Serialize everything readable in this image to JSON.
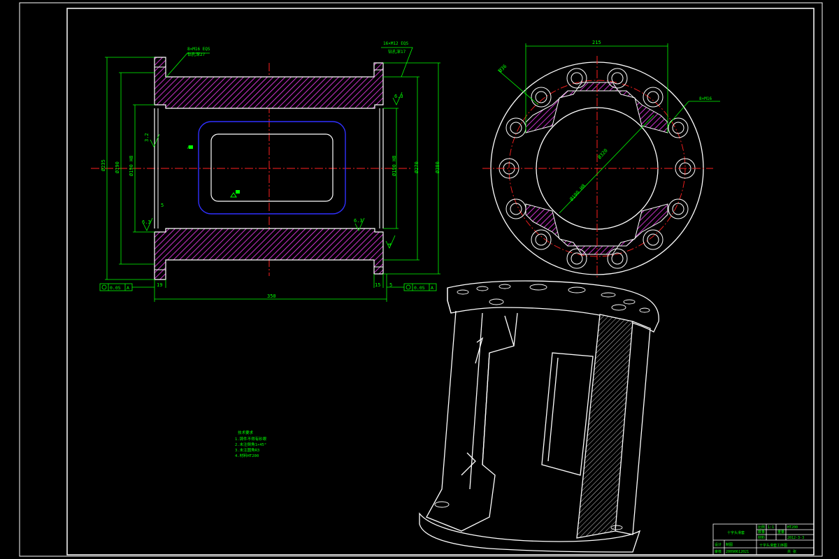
{
  "colors": {
    "background": "#000000",
    "outline": "#ffffff",
    "dimension": "#00ff00",
    "centerline": "#ff2020",
    "hatch": "#ff40ff",
    "hidden": "#3030ff",
    "leader": "#00ff00"
  },
  "front_view": {
    "dim_length": "350",
    "dim_left_flange": "19",
    "dim_right_flange": "15",
    "dim_right_small": "5",
    "dim_od_left": "Ø235",
    "dim_id_left": "Ø190",
    "dim_bore_left": "Ø190 H8",
    "dim_bore_right": "Ø190 H8",
    "dim_od_right": "Ø270",
    "dim_outer_right": "Ø380",
    "roughness_1": "6.3",
    "roughness_2": "6.3",
    "roughness_3": "6.3",
    "roughness_4": "3.2",
    "dim_groove": "5",
    "small_tick": "4",
    "note_left_top": "8×M16 EQS",
    "note_left_sub": "钻孔深27",
    "note_right_top": "16×M12 EQS",
    "note_right_sub": "钻孔深17",
    "tol_left": "0.05",
    "tol_left_ref": "A",
    "tol_right": "0.05",
    "tol_right_ref": "A",
    "marker_a": "A"
  },
  "side_view": {
    "dim_width": "215",
    "dim_hole": "Ø36",
    "dim_bolt_circle": "Ø320",
    "dim_inner": "Ø190 H8",
    "note_right": "8×M16"
  },
  "tech_notes": {
    "title": "技术要求",
    "line1": "1.铸件不得有砂眼",
    "line2": "2.未注倒角1×45°",
    "line3": "3.未注圆角R3",
    "line4": "4.材料HT200"
  },
  "title_block": {
    "company": "十字头滑套",
    "drawing_name": "十字头滑套工序图",
    "label_design": "设计",
    "label_check": "审核",
    "label_scale": "比例",
    "label_qty": "数量",
    "label_material": "材料",
    "scale_value": "1:1",
    "material_value": "HT200",
    "label_drawn": "制图",
    "label_weight": "重量",
    "date_value": "2012-3-3",
    "student_id": "20090612021",
    "label_sheet": "共 张"
  }
}
